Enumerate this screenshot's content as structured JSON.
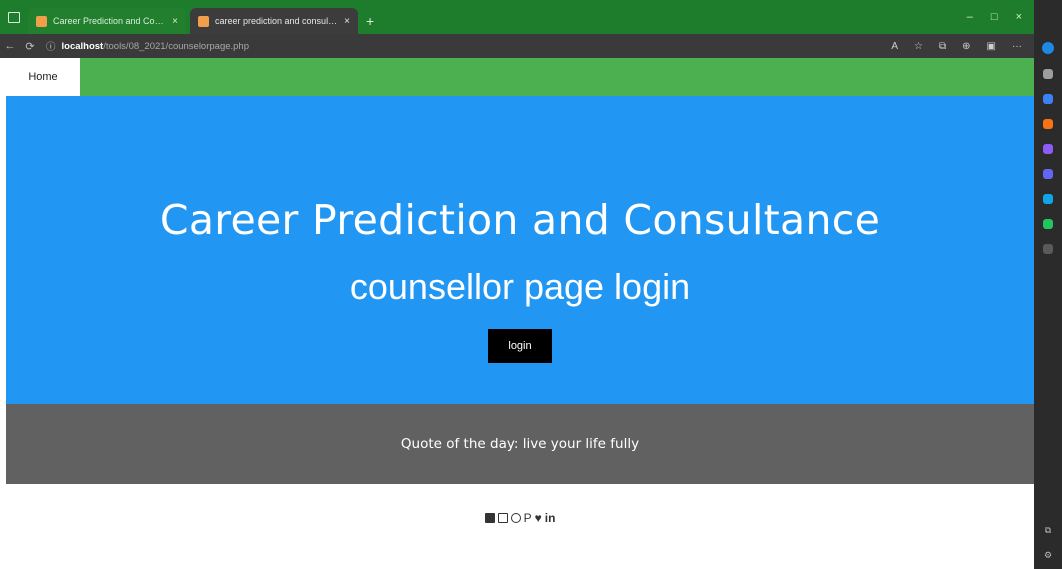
{
  "browser": {
    "tabs": [
      {
        "title": "Career Prediction and Consultance",
        "close": "×"
      },
      {
        "title": "career prediction and consultanc",
        "close": "×"
      }
    ],
    "new_tab": "+",
    "window_controls": [
      "–",
      "□",
      "×"
    ],
    "url": {
      "host": "localhost",
      "path": "/tools/08_2021/counselorpage.php"
    },
    "nav": {
      "back": "←",
      "reload": "⟳",
      "info": "ⓘ"
    },
    "addr_icons": [
      "A",
      "☆",
      "⧉",
      "⊕",
      "▣",
      "···"
    ]
  },
  "sidebar": {
    "icons": [
      "bing-icon",
      "search-icon",
      "tag-icon",
      "office-icon",
      "outlook-icon",
      "games-icon",
      "tools-icon",
      "drop-icon",
      "plus-icon"
    ],
    "icon_colors": [
      "#1e88e5",
      "#9e9e9e",
      "#3b82f6",
      "#f97316",
      "#8b5cf6",
      "#6366f1",
      "#0ea5e9",
      "#22c55e",
      "#9e9e9e"
    ],
    "bottom": [
      "⧉",
      "⚙"
    ]
  },
  "page": {
    "nav": {
      "home": "Home"
    },
    "hero": {
      "title": "Career Prediction and Consultance",
      "subtitle": "counsellor page login",
      "login_button": "login"
    },
    "quote": "Quote of the day: live your life fully",
    "social": {
      "icons": [
        "facebook-icon",
        "instagram-icon",
        "snapchat-icon",
        "pinterest-icon",
        "twitter-icon",
        "linkedin-icon"
      ],
      "pinterest_glyph": "P",
      "twitter_glyph": "♥",
      "linkedin_label": "in"
    }
  },
  "colors": {
    "tab_bar": "#1d7d2c",
    "nav_green": "#4caf50",
    "hero_blue": "#2196f3",
    "quote_gray": "#616161"
  }
}
